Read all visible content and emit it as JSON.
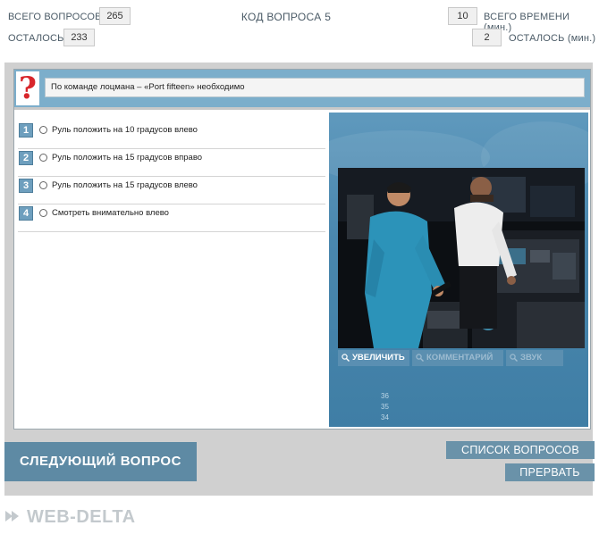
{
  "stats": {
    "total_questions_label": "ВСЕГО ВОПРОСОВ",
    "total_questions_value": "265",
    "remaining_label": "ОСТАЛОСЬ",
    "remaining_value": "233",
    "code_title": "КОД ВОПРОСА 5",
    "total_time_label": "ВСЕГО ВРЕМЕНИ (мин.)",
    "total_time_value": "10",
    "time_left_label": "ОСТАЛОСЬ (мин.)",
    "time_left_value": "2"
  },
  "question": {
    "text": "По команде лоцмана – «Port fifteen» необходимо"
  },
  "answers": [
    {
      "num": "1",
      "text": "Руль положить на 10 градусов влево"
    },
    {
      "num": "2",
      "text": "Руль положить на 15 градусов вправо"
    },
    {
      "num": "3",
      "text": "Руль положить на 15 градусов влево"
    },
    {
      "num": "4",
      "text": "Смотреть внимательно влево"
    }
  ],
  "media": {
    "zoom_label": "УВЕЛИЧИТЬ",
    "comment_label": "КОММЕНТАРИЙ",
    "sound_label": "ЗВУК",
    "side_numbers": [
      "36",
      "35",
      "34"
    ]
  },
  "buttons": {
    "next_question": "СЛЕДУЮЩИЙ ВОПРОС",
    "question_list": "СПИСОК ВОПРОСОВ",
    "abort": "ПРЕРВАТЬ"
  },
  "logo": {
    "text": "WEB-DELTA"
  },
  "colors": {
    "accent": "#5e8aa4",
    "question_bar": "#7caecb",
    "media_panel": "#4a87ae"
  },
  "icons": {
    "question": "question-mark-icon",
    "magnifier": "magnifier-icon",
    "logo": "web-delta-logo-icon"
  }
}
